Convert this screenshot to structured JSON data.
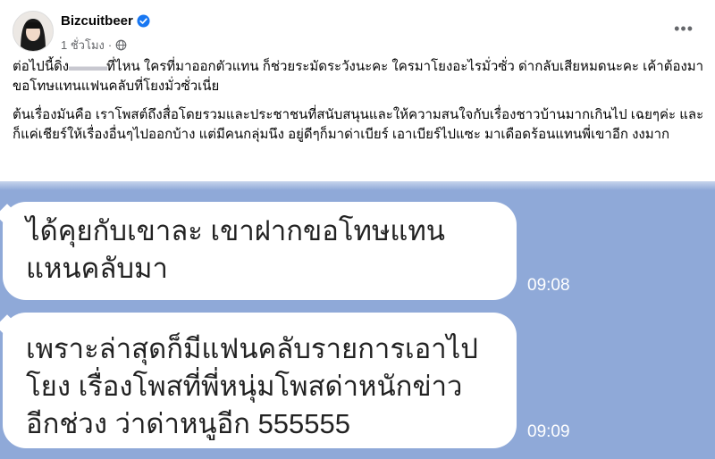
{
  "post": {
    "author": "Bizcuitbeer",
    "timestamp": "1 ชั่วโมง",
    "more_label": "•••",
    "icons": {
      "verified": "verified-badge-icon",
      "audience": "globe-icon",
      "more": "more-options-icon"
    },
    "caption": {
      "p1_pre": "ต่อไปนี้ดิ่ง",
      "p1_censored": "▬▬▬",
      "p1_post": "ที่ไหน ใครที่มาออกตัวแทน ก็ช่วยระมัดระวังนะคะ ใครมาโยงอะไรมั่วซั่ว ด่ากลับเสียหมดนะคะ เค้าต้องมาขอโทษแทนแฟนคลับที่โยงมั่วซั่วเนี่ย",
      "p2": "ต้นเรื่องมันคือ เราโพสต์ถึงสื่อโดยรวมและประชาชนที่สนับสนุนและให้ความสนใจกับเรื่องชาวบ้านมากเกินไป เฉยๆค่ะ และก็แค่เชียร์ให้เรื่องอื่นๆไปออกบ้าง แต่มีคนกลุ่มนึง อยู่ดีๆก็มาด่าเบียร์ เอาเบียร์ไปแซะ มาเดือดร้อนแทนพี่เขาอีก งงมาก"
    }
  },
  "chat": {
    "messages": [
      {
        "text": "ได้คุยกับเขาละ เขาฝากขอโทษแทนแหนคลับมา",
        "time": "09:08"
      },
      {
        "text": "เพราะล่าสุดก็มีแฟนคลับรายการเอาไปโยง เรื่องโพสที่พี่หนุ่มโพสด่าหนักข่าวอีกช่วง ว่าด่าหนูอีก 555555",
        "time": "09:09"
      }
    ]
  },
  "colors": {
    "chat_background": "#8fa9d8",
    "bubble": "#ffffff",
    "verified": "#1877f2",
    "meta_text": "#65676b"
  }
}
